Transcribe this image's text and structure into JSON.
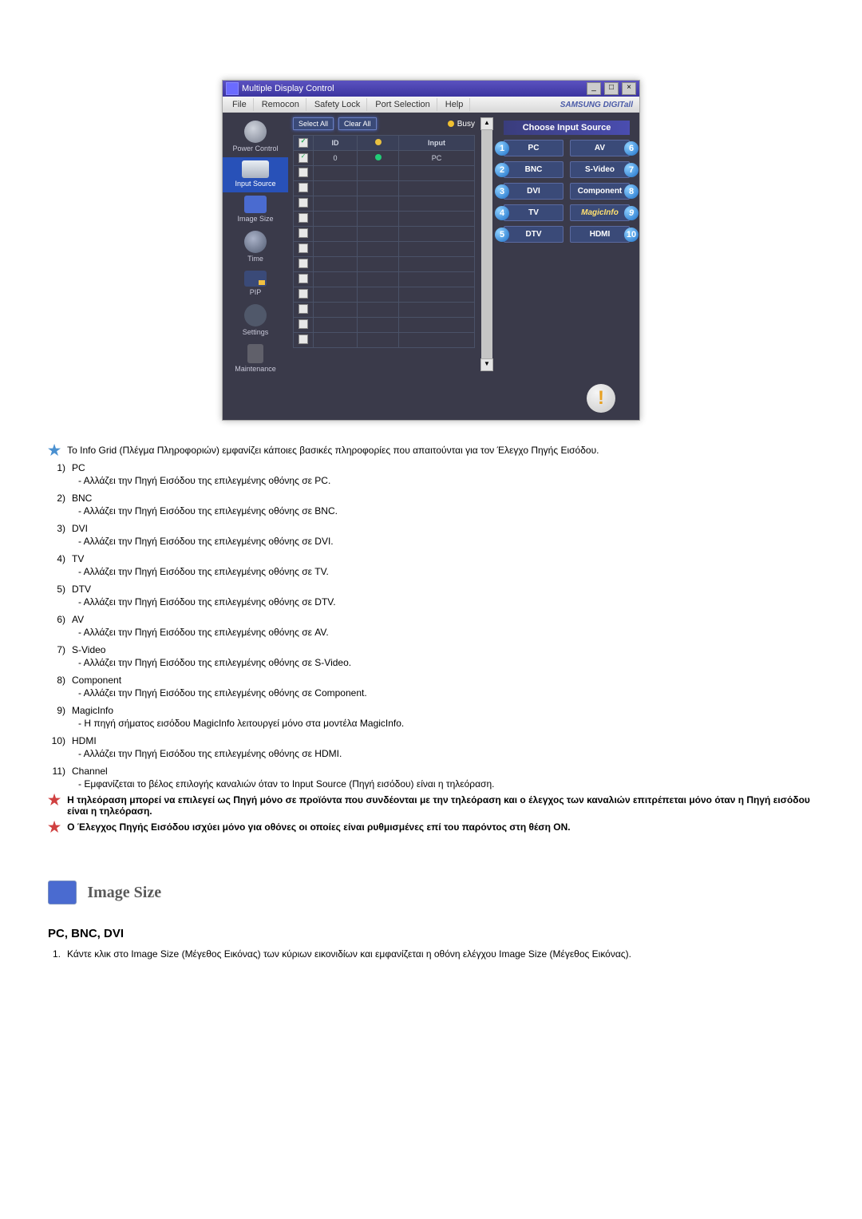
{
  "app": {
    "title": "Multiple Display Control",
    "menus": [
      "File",
      "Remocon",
      "Safety Lock",
      "Port Selection",
      "Help"
    ],
    "brand": "SAMSUNG DIGITall"
  },
  "sidebar": [
    {
      "label": "Power Control",
      "icon": "power",
      "active": false
    },
    {
      "label": "Input Source",
      "icon": "input",
      "active": true
    },
    {
      "label": "Image Size",
      "icon": "image",
      "active": false
    },
    {
      "label": "Time",
      "icon": "time",
      "active": false
    },
    {
      "label": "PIP",
      "icon": "pip",
      "active": false
    },
    {
      "label": "Settings",
      "icon": "settings",
      "active": false
    },
    {
      "label": "Maintenance",
      "icon": "maint",
      "active": false
    }
  ],
  "topbar": {
    "select_all": "Select All",
    "clear_all": "Clear All",
    "busy": "Busy"
  },
  "grid": {
    "headers": {
      "id": "ID",
      "input": "Input"
    },
    "row": {
      "id": "0",
      "input": "PC"
    }
  },
  "choose": {
    "title": "Choose Input Source",
    "left": [
      {
        "n": "1",
        "label": "PC"
      },
      {
        "n": "2",
        "label": "BNC"
      },
      {
        "n": "3",
        "label": "DVI"
      },
      {
        "n": "4",
        "label": "TV"
      },
      {
        "n": "5",
        "label": "DTV"
      }
    ],
    "right": [
      {
        "n": "6",
        "label": "AV"
      },
      {
        "n": "7",
        "label": "S-Video"
      },
      {
        "n": "8",
        "label": "Component"
      },
      {
        "n": "9",
        "label": "MagicInfo"
      },
      {
        "n": "10",
        "label": "HDMI"
      }
    ]
  },
  "desc": {
    "intro": "Το Info Grid (Πλέγμα Πληροφοριών) εμφανίζει κάποιες βασικές πληροφορίες που απαιτούνται για τον Έλεγχο Πηγής Εισόδου.",
    "items": [
      {
        "n": "1)",
        "name": "PC",
        "text": "- Αλλάζει την Πηγή Εισόδου της επιλεγμένης οθόνης σε PC."
      },
      {
        "n": "2)",
        "name": "BNC",
        "text": "- Αλλάζει την Πηγή Εισόδου της επιλεγμένης οθόνης σε BNC."
      },
      {
        "n": "3)",
        "name": "DVI",
        "text": "- Αλλάζει την Πηγή Εισόδου της επιλεγμένης οθόνης σε DVI."
      },
      {
        "n": "4)",
        "name": "TV",
        "text": "- Αλλάζει την Πηγή Εισόδου της επιλεγμένης οθόνης σε TV."
      },
      {
        "n": "5)",
        "name": "DTV",
        "text": "- Αλλάζει την Πηγή Εισόδου της επιλεγμένης οθόνης σε DTV."
      },
      {
        "n": "6)",
        "name": "AV",
        "text": "- Αλλάζει την Πηγή Εισόδου της επιλεγμένης οθόνης σε AV."
      },
      {
        "n": "7)",
        "name": "S-Video",
        "text": "- Αλλάζει την Πηγή Εισόδου της επιλεγμένης οθόνης σε S-Video."
      },
      {
        "n": "8)",
        "name": "Component",
        "text": "- Αλλάζει την Πηγή Εισόδου της επιλεγμένης οθόνης σε Component."
      },
      {
        "n": "9)",
        "name": "MagicInfo",
        "text": "- Η πηγή σήματος εισόδου MagicInfo λειτουργεί μόνο στα μοντέλα MagicInfo."
      },
      {
        "n": "10)",
        "name": "HDMI",
        "text": "- Αλλάζει την Πηγή Εισόδου της επιλεγμένης οθόνης σε HDMI."
      },
      {
        "n": "11)",
        "name": "Channel",
        "text": "- Εμφανίζεται το βέλος επιλογής καναλιών όταν το Input Source (Πηγή εισόδου) είναι η τηλεόραση."
      }
    ],
    "notes": [
      "Η τηλεόραση μπορεί να επιλεγεί ως Πηγή μόνο σε προϊόντα που συνδέονται με την τηλεόραση και ο έλεγχος των καναλιών επιτρέπεται μόνο όταν η Πηγή εισόδου είναι η τηλεόραση.",
      "Ο Έλεγχος Πηγής Εισόδου ισχύει μόνο για οθόνες οι οποίες είναι ρυθμισμένες επί του παρόντος στη θέση ON."
    ]
  },
  "section": {
    "title": "Image Size",
    "sub": "PC, BNC, DVI",
    "steps": [
      "Κάντε κλικ στο Image Size (Μέγεθος Εικόνας) των κύριων εικονιδίων και εμφανίζεται η οθόνη ελέγχου Image Size (Μέγεθος Εικόνας)."
    ]
  }
}
